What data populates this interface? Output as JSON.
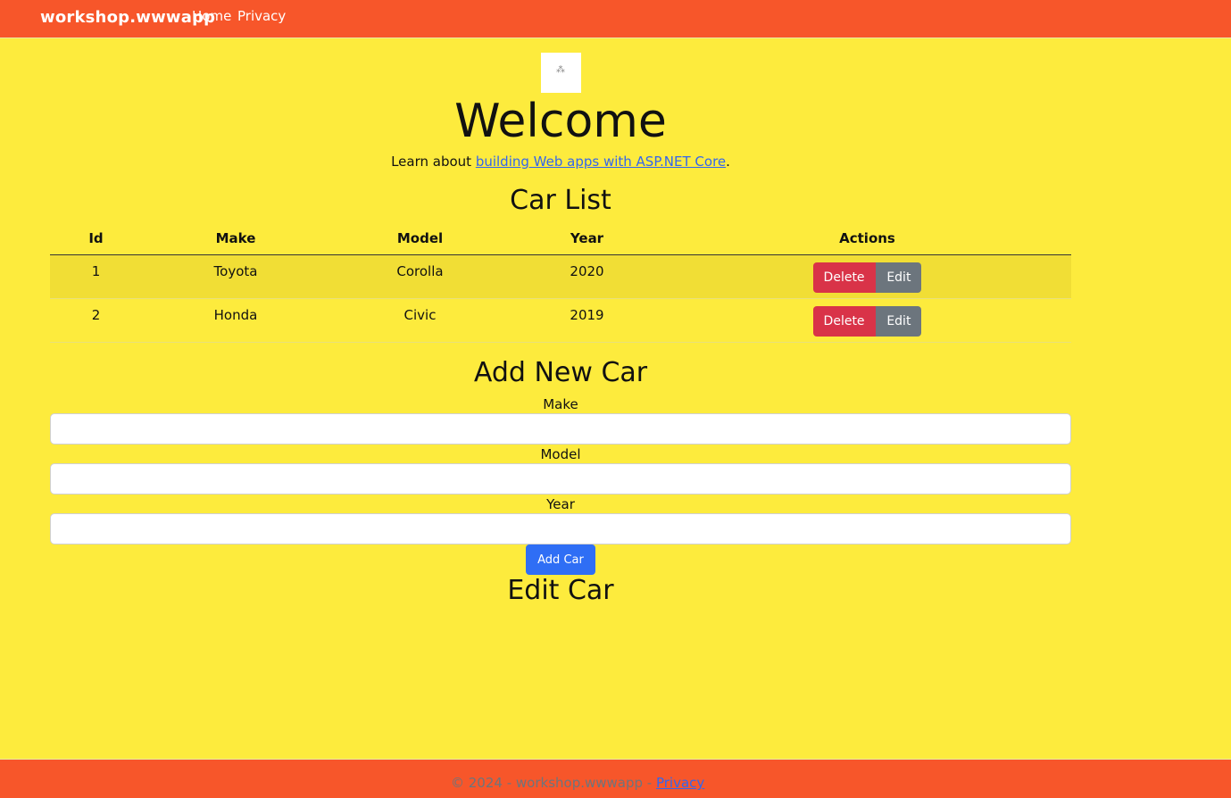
{
  "navbar": {
    "brand": "workshop.wwwapp",
    "links": [
      {
        "label": "Home"
      },
      {
        "label": "Privacy"
      }
    ],
    "color": "#f7562a"
  },
  "page": {
    "background": "#fdeb3d",
    "welcome_title": "Welcome",
    "learn_prefix": "Learn about ",
    "learn_link": "building Web apps with ASP.NET Core",
    "learn_suffix": "."
  },
  "car_list": {
    "title": "Car List",
    "columns": [
      "Id",
      "Make",
      "Model",
      "Year",
      "Actions"
    ],
    "rows": [
      {
        "id": "1",
        "make": "Toyota",
        "model": "Corolla",
        "year": "2020"
      },
      {
        "id": "2",
        "make": "Honda",
        "model": "Civic",
        "year": "2019"
      }
    ],
    "delete_label": "Delete",
    "edit_label": "Edit"
  },
  "add_car": {
    "title": "Add New Car",
    "make_label": "Make",
    "model_label": "Model",
    "year_label": "Year",
    "make_value": "",
    "model_value": "",
    "year_value": "",
    "submit_label": "Add Car"
  },
  "edit_car": {
    "title": "Edit Car"
  },
  "footer": {
    "copyright": "© 2024 - workshop.wwwapp - ",
    "privacy_link": "Privacy"
  }
}
